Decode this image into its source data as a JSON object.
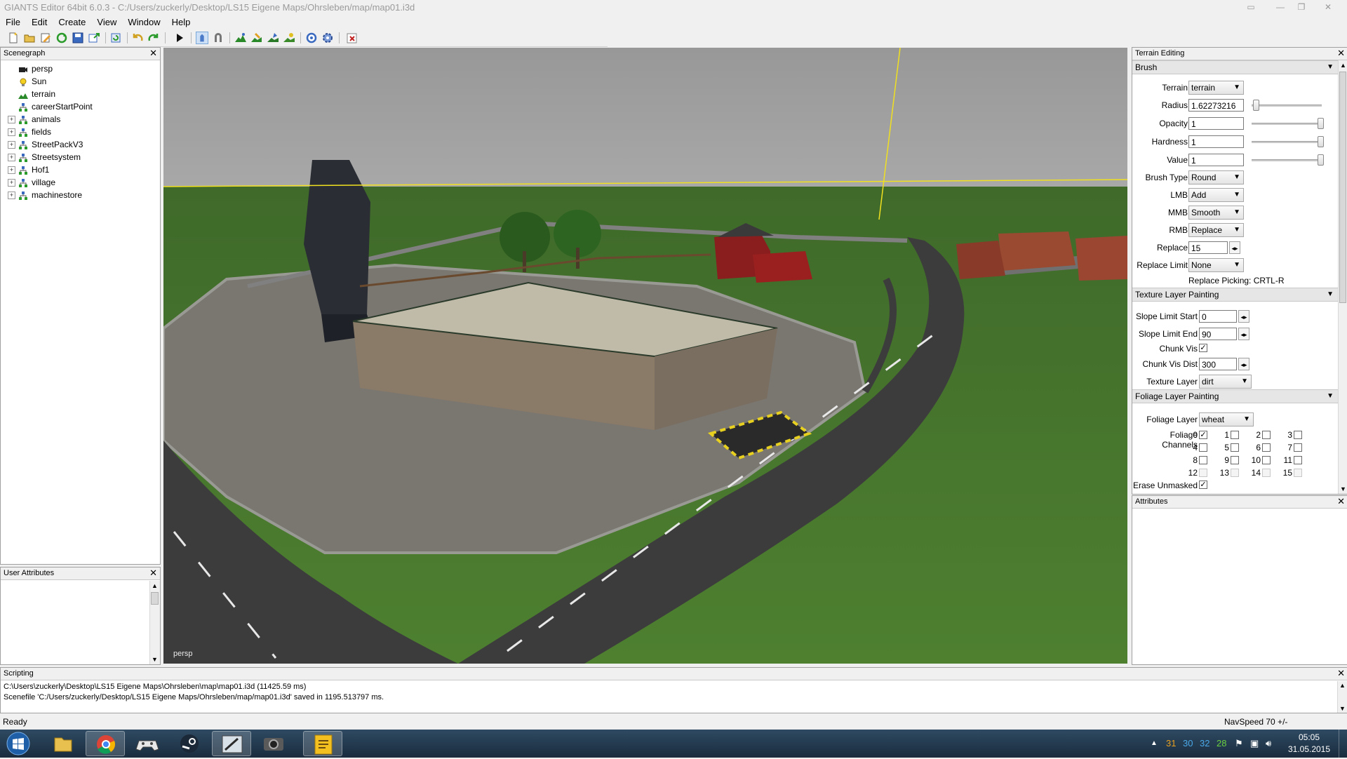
{
  "window": {
    "title": "GIANTS Editor 64bit 6.0.3 - C:/Users/zuckerly/Desktop/LS15 Eigene Maps/Ohrsleben/map/map01.i3d"
  },
  "menu": [
    "File",
    "Edit",
    "Create",
    "View",
    "Window",
    "Help"
  ],
  "toolbar": {
    "icons": [
      "new-file-icon",
      "open-folder-icon",
      "edit-icon",
      "reload-icon",
      "save-icon",
      "export-icon",
      "refresh-icon",
      "undo-icon",
      "redo-icon",
      "play-icon",
      "select-mode-icon",
      "magnet-icon",
      "terrain-tool-icon",
      "paint-tool-icon",
      "foliage-tool-icon",
      "decal-tool-icon",
      "snap-settings-icon",
      "settings-gear-icon",
      "export-tool-icon"
    ]
  },
  "scenegraph": {
    "title": "Scenegraph",
    "items": [
      {
        "label": "persp",
        "icon": "camera-icon",
        "expandable": false
      },
      {
        "label": "Sun",
        "icon": "light-bulb-icon",
        "expandable": false
      },
      {
        "label": "terrain",
        "icon": "terrain-icon",
        "expandable": false
      },
      {
        "label": "careerStartPoint",
        "icon": "transform-group-icon",
        "expandable": false
      },
      {
        "label": "animals",
        "icon": "transform-group-icon",
        "expandable": true
      },
      {
        "label": "fields",
        "icon": "transform-group-icon",
        "expandable": true
      },
      {
        "label": "StreetPackV3",
        "icon": "transform-group-icon",
        "expandable": true
      },
      {
        "label": "Streetsystem",
        "icon": "transform-group-icon",
        "expandable": true
      },
      {
        "label": "Hof1",
        "icon": "transform-group-icon",
        "expandable": true
      },
      {
        "label": "village",
        "icon": "transform-group-icon",
        "expandable": true
      },
      {
        "label": "machinestore",
        "icon": "transform-group-icon",
        "expandable": true
      }
    ]
  },
  "user_attributes": {
    "title": "User Attributes"
  },
  "viewport": {
    "camera_label": "persp"
  },
  "terrain_editing": {
    "title": "Terrain Editing",
    "brush": {
      "title": "Brush",
      "terrain_label": "Terrain",
      "terrain_value": "terrain",
      "radius_label": "Radius",
      "radius_value": "1.62273216",
      "opacity_label": "Opacity",
      "opacity_value": "1",
      "hardness_label": "Hardness",
      "hardness_value": "1",
      "value_label": "Value",
      "value_value": "1",
      "brush_type_label": "Brush Type",
      "brush_type_value": "Round",
      "lmb_label": "LMB",
      "lmb_value": "Add",
      "mmb_label": "MMB",
      "mmb_value": "Smooth",
      "rmb_label": "RMB",
      "rmb_value": "Replace",
      "replace_label": "Replace",
      "replace_value": "15",
      "replace_limit_label": "Replace Limit",
      "replace_limit_value": "None",
      "replace_picking": "Replace Picking: CRTL-R"
    },
    "texture": {
      "title": "Texture Layer Painting",
      "slope_start_label": "Slope Limit Start",
      "slope_start_value": "0",
      "slope_end_label": "Slope Limit End",
      "slope_end_value": "90",
      "chunk_vis_label": "Chunk Vis",
      "chunk_vis_dist_label": "Chunk Vis Dist",
      "chunk_vis_dist_value": "300",
      "texture_layer_label": "Texture Layer",
      "texture_layer_value": "dirt"
    },
    "foliage": {
      "title": "Foliage Layer Painting",
      "foliage_layer_label": "Foliage Layer",
      "foliage_layer_value": "wheat",
      "foliage_channels_label": "Foliage Channels",
      "channels": [
        "0",
        "1",
        "2",
        "3",
        "4",
        "5",
        "6",
        "7",
        "8",
        "9",
        "10",
        "11",
        "12",
        "13",
        "14",
        "15"
      ],
      "erase_unmasked_label": "Erase Unmasked"
    }
  },
  "attributes": {
    "title": "Attributes"
  },
  "scripting": {
    "title": "Scripting",
    "lines": [
      "C:\\Users\\zuckerly\\Desktop\\LS15 Eigene Maps\\Ohrsleben\\map\\map01.i3d (11425.59 ms)",
      "Scenefile 'C:/Users/zuckerly/Desktop/LS15 Eigene Maps/Ohrsleben/map/map01.i3d' saved in 1195.513797 ms."
    ]
  },
  "statusbar": {
    "left": "Ready",
    "right": "NavSpeed 70 +/-"
  },
  "taskbar": {
    "apps": [
      "windows-start-icon",
      "file-explorer-icon",
      "chrome-icon",
      "game-controller-icon",
      "steam-icon",
      "giants-editor-icon",
      "camera-app-icon",
      "notes-app-icon"
    ],
    "tray_numbers": [
      "31",
      "30",
      "32",
      "28"
    ],
    "time": "05:05",
    "date": "31.05.2015"
  },
  "colors": {
    "accent_yellow": "#f0e020",
    "grass": "#4a7a2a",
    "sky": "#9a9a9a",
    "asphalt": "#3c3c3c"
  }
}
